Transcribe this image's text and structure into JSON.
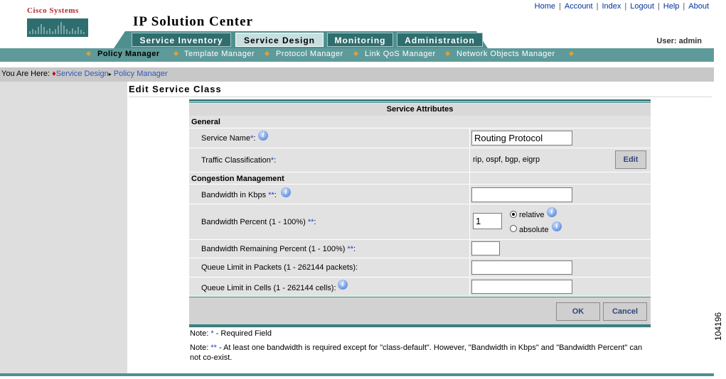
{
  "brand": {
    "logo_text": "Cisco Systems",
    "app_title": "IP Solution Center"
  },
  "top_links": [
    "Home",
    "Account",
    "Index",
    "Logout",
    "Help",
    "About"
  ],
  "user": "User: admin",
  "tabs": [
    {
      "label": "Service Inventory",
      "active": false
    },
    {
      "label": "Service Design",
      "active": true
    },
    {
      "label": "Monitoring",
      "active": false
    },
    {
      "label": "Administration",
      "active": false
    }
  ],
  "subnav": [
    {
      "label": "Policy Manager",
      "active": true
    },
    {
      "label": "Template Manager",
      "active": false
    },
    {
      "label": "Protocol Manager",
      "active": false
    },
    {
      "label": "Link QoS Manager",
      "active": false
    },
    {
      "label": "Network Objects Manager",
      "active": false
    }
  ],
  "breadcrumb": {
    "prefix": "You Are Here:",
    "items": [
      "Service Design",
      "Policy Manager"
    ]
  },
  "page_title": "Edit Service Class",
  "form": {
    "header": "Service Attributes",
    "general": "General",
    "service_name_label": "Service Name",
    "service_name_value": "Routing Protocol",
    "traffic_label": "Traffic Classification",
    "traffic_value": "rip, ospf, bgp, eigrp",
    "edit_label": "Edit",
    "congestion": "Congestion Management",
    "bw_kbps_label": "Bandwidth in Kbps",
    "bw_kbps_value": "",
    "bw_pct_label": "Bandwidth Percent (1  - 100%)",
    "bw_pct_value": "1",
    "relative_label": "relative",
    "absolute_label": "absolute",
    "bw_mode_selected": "relative",
    "bw_remaining_label": "Bandwidth Remaining Percent (1  - 100%)",
    "bw_remaining_value": "",
    "queue_packets_label": "Queue Limit in Packets (1  - 262144 packets):",
    "queue_packets_value": "",
    "queue_cells_label": "Queue Limit in Cells (1  - 262144 cells):",
    "queue_cells_value": "",
    "ok_label": "OK",
    "cancel_label": "Cancel"
  },
  "notes": {
    "note1_prefix": "Note:",
    "note1_marker": "*",
    "note1_text": " - Required Field",
    "note2_prefix": "Note:",
    "note2_marker": "**",
    "note2_text": " - At least one bandwidth is required except for \"class-default\". However, \"Bandwidth in Kbps\" and \"Bandwidth Percent\" can not co-exist."
  },
  "figure_number": "104196",
  "colors": {
    "teal": "#4f8f8f",
    "active_tab": "#c8dfdf",
    "link": "#003399",
    "logo": "#b3262c"
  }
}
